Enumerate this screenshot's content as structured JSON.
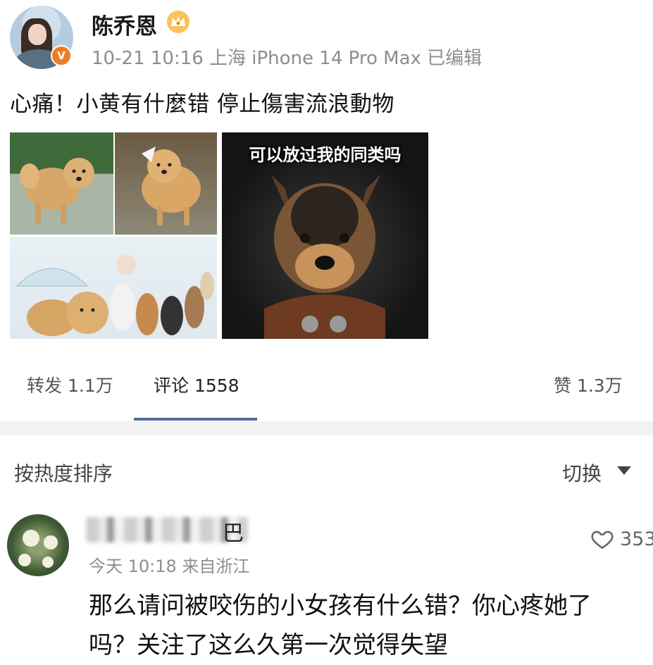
{
  "post": {
    "author": "陈乔恩",
    "meta": "10-21 10:16 上海 iPhone 14 Pro Max 已编辑",
    "verified_badge": "V",
    "text": "心痛！小黄有什麼错 停止傷害流浪動物",
    "meme_caption": "可以放过我的同类吗"
  },
  "actions": {
    "repost": "转发 1.1万",
    "comment": "评论 1558",
    "like": "赞 1.3万"
  },
  "comments_header": {
    "sort": "按热度排序",
    "switch": "切换"
  },
  "comment": {
    "name_suffix": "巴",
    "meta": "今天 10:18 来自浙江",
    "likes": "353",
    "text": "那么请问被咬伤的小女孩有什么错？你心疼她了吗？关注了这么久第一次觉得失望"
  },
  "colors": {
    "accent": "#4f6b9b",
    "badge": "#f07c1f",
    "divider": "#f2f2f2"
  }
}
